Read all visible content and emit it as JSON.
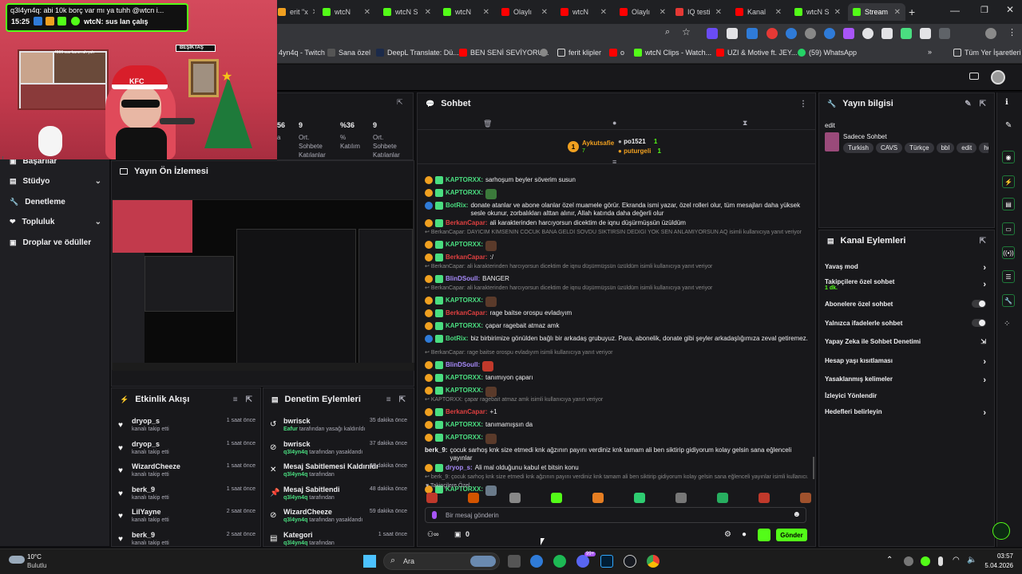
{
  "browser": {
    "tabs": [
      {
        "label": "erit \"x",
        "color": "#f0a020"
      },
      {
        "label": "wtcN",
        "color": "#53fc18"
      },
      {
        "label": "wtcN S",
        "color": "#53fc18"
      },
      {
        "label": "wtcN",
        "color": "#53fc18"
      },
      {
        "label": "Olaylı",
        "color": "#ff0000"
      },
      {
        "label": "wtcN",
        "color": "#ff0000"
      },
      {
        "label": "Olaylı",
        "color": "#ff0000"
      },
      {
        "label": "IQ testi",
        "color": "#e53935"
      },
      {
        "label": "Kanal",
        "color": "#ff0000"
      },
      {
        "label": "wtcN S",
        "color": "#53fc18"
      },
      {
        "label": "Stream",
        "color": "#53fc18"
      }
    ],
    "bookmarks": [
      "4yn4q - Twitch",
      "Sana özel",
      "DeepL Translate: Dü...",
      "BEN SENİ SEVİYORU...",
      "ferit klipler",
      "o",
      "wtcN Clips - Watch...",
      "UZI & Motive ft. JEY...",
      "(59) WhatsApp",
      "Tüm Yer İşaretleri"
    ]
  },
  "overlay": {
    "chat_top": "q3l4yn4q: abi 10k borç var mı ya tuhh @wtcn i...",
    "time": "15:25",
    "chat_bottom": "wtcN: sus lan çalış",
    "sign": "BEŞİKTAŞ",
    "cap": "KFC",
    "small_text": "4666 sus kanın ah ysh"
  },
  "stats": [
    {
      "value": "56",
      "label": "a"
    },
    {
      "value": "9",
      "label": "Ort. Sohbete Katılanlar"
    },
    {
      "value": "%36",
      "label": "% Katılım"
    },
    {
      "value": "9",
      "label": "Ort. Sohbete Katılanlar"
    }
  ],
  "leftnav": [
    {
      "label": "Başarılar",
      "chev": ""
    },
    {
      "label": "Stüdyo",
      "chev": "⌄"
    },
    {
      "label": "Denetleme",
      "chev": ""
    },
    {
      "label": "Topluluk",
      "chev": "⌄"
    },
    {
      "label": "Droplar ve ödüller",
      "chev": ""
    }
  ],
  "preview": {
    "title": "Yayın Ön İzlemesi"
  },
  "activity": {
    "title": "Etkinlik Akışı",
    "items": [
      {
        "name": "dryop_s",
        "sub": "kanalı takip etti",
        "time": "1 saat önce"
      },
      {
        "name": "dryop_s",
        "sub": "kanalı takip etti",
        "time": "1 saat önce"
      },
      {
        "name": "WizardCheeze",
        "sub": "kanalı takip etti",
        "time": "1 saat önce"
      },
      {
        "name": "berk_9",
        "sub": "kanalı takip etti",
        "time": "1 saat önce"
      },
      {
        "name": "LilYayne",
        "sub": "kanalı takip etti",
        "time": "2 saat önce"
      },
      {
        "name": "berk_9",
        "sub": "kanalı takip etti",
        "time": "2 saat önce"
      }
    ]
  },
  "moderation": {
    "title": "Denetim Eylemleri",
    "items": [
      {
        "icon": "↺",
        "name": "bwrisck",
        "actor": "Eafur",
        "sub": " tarafından yasağı kaldırıldı",
        "time": "35 dakika önce"
      },
      {
        "icon": "⊘",
        "name": "bwrisck",
        "actor": "q3l4yn4q",
        "sub": " tarafından yasaklandı",
        "time": "37 dakika önce"
      },
      {
        "icon": "✕",
        "name": "Mesaj Sabitlemesi Kaldırıldı",
        "actor": "q3l4yn4q",
        "sub": " tarafından",
        "time": "48 dakika önce"
      },
      {
        "icon": "📌",
        "name": "Mesaj Sabitlendi",
        "actor": "q3l4yn4q",
        "sub": " tarafından",
        "time": "48 dakika önce"
      },
      {
        "icon": "⊘",
        "name": "WizardCheeze",
        "actor": "q3l4yn4q",
        "sub": " tarafından yasaklandı",
        "time": "59 dakika önce"
      },
      {
        "icon": "▤",
        "name": "Kategori",
        "actor": "q3l4yn4q",
        "sub": " tarafından",
        "time": "1 saat önce"
      }
    ]
  },
  "chat": {
    "title": "Sohbet",
    "pinned_users": [
      {
        "name": "Aykutsafie",
        "count": "7"
      },
      {
        "name": "po1521",
        "count": "1"
      },
      {
        "name": "puturgeli",
        "count": "1"
      }
    ],
    "messages": [
      {
        "kind": "msg",
        "user": "KAPTORXX",
        "color": "#4ade80",
        "text": "sarhoşum beyler söverim susun",
        "badge": "#f0a020"
      },
      {
        "kind": "msg",
        "user": "KAPTORXX",
        "color": "#4ade80",
        "text": "",
        "badge": "#f0a020",
        "emote": "#3b7a3b"
      },
      {
        "kind": "msg",
        "user": "BotRix",
        "color": "#4ade80",
        "text": "donate atanlar ve abone olanlar özel muamele görür. Ekranda ismi yazar, özel rolleri olur, tüm mesajları daha yüksek sesle okunur, zorbalıkları alttan alınır, Allah katında daha değerli olur",
        "badge": "#2f7bd8"
      },
      {
        "kind": "msg",
        "user": "BerkanCapar",
        "color": "#e04040",
        "text": "ali karakterinden harcıyorsun dicektim de iqnu düşürmüşsün üzüldüm",
        "badge": "#f0a020"
      },
      {
        "kind": "reply",
        "text": "BerkanCapar: DAYICIM KİMSENİN COCUK BANA GELDİ SOVDU SİKTİRSİN DEDİGİ YOK SEN ANLAMIYORSUN AQ isimli kullanıcıya yanıt veriyor"
      },
      {
        "kind": "msg",
        "user": "KAPTORXX",
        "color": "#4ade80",
        "text": "",
        "badge": "#f0a020",
        "emote": "#5a3a2a"
      },
      {
        "kind": "msg",
        "user": "BerkanCapar",
        "color": "#e04040",
        "text": ":/",
        "badge": "#f0a020"
      },
      {
        "kind": "reply",
        "text": "BerkanCapar: ali karakterinden harcıyorsun dicektim de iqnu düşürmüşsün üzüldüm isimli kullanıcıya yanıt veriyor"
      },
      {
        "kind": "msg",
        "user": "BlinDSoull",
        "color": "#a78bfa",
        "text": "BANGER",
        "badge": "#f0a020"
      },
      {
        "kind": "reply",
        "text": "BerkanCapar: ali karakterinden harcıyorsun dicektim de iqnu düşürmüşsün üzüldüm isimli kullanıcıya yanıt veriyor"
      },
      {
        "kind": "msg",
        "user": "KAPTORXX",
        "color": "#4ade80",
        "text": "",
        "badge": "#f0a020",
        "emote": "#5a3a2a"
      },
      {
        "kind": "msg",
        "user": "BerkanCapar",
        "color": "#e04040",
        "text": "rage baitse orospu evladıyım",
        "badge": "#f0a020"
      },
      {
        "kind": "msg",
        "user": "KAPTORXX",
        "color": "#4ade80",
        "text": "çapar ragebait atmaz amk",
        "badge": "#f0a020"
      },
      {
        "kind": "msg",
        "user": "BotRix",
        "color": "#4ade80",
        "text": "biz birbirimize gönülden bağlı bir arkadaş grubuyuz. Para, abonelik, donate gibi şeyler arkadaşlığımıza zeval getiremez.",
        "badge": "#2f7bd8"
      },
      {
        "kind": "reply",
        "text": "BerkanCapar: rage baitse orospu evladıyım isimli kullanıcıya yanıt veriyor"
      },
      {
        "kind": "msg",
        "user": "BlinDSoull",
        "color": "#a78bfa",
        "text": "",
        "badge": "#f0a020",
        "emote": "#c0392b"
      },
      {
        "kind": "msg",
        "user": "KAPTORXX",
        "color": "#4ade80",
        "text": "tanımıyon çaparı",
        "badge": "#f0a020"
      },
      {
        "kind": "msg",
        "user": "KAPTORXX",
        "color": "#4ade80",
        "text": "",
        "badge": "#f0a020",
        "emote": "#5a3a2a"
      },
      {
        "kind": "reply",
        "text": "KAPTORXX: çapar ragebait atmaz amk isimli kullanıcıya yanıt veriyor"
      },
      {
        "kind": "msg",
        "user": "BerkanCapar",
        "color": "#e04040",
        "text": "+1",
        "badge": "#f0a020"
      },
      {
        "kind": "msg",
        "user": "KAPTORXX",
        "color": "#4ade80",
        "text": "tanımamışsın da",
        "badge": "#f0a020"
      },
      {
        "kind": "msg",
        "user": "KAPTORXX",
        "color": "#4ade80",
        "text": "",
        "badge": "#f0a020",
        "emote": "#5a3a2a"
      },
      {
        "kind": "msg",
        "user": "berk_9",
        "color": "#efeff1",
        "text": "çocuk sarhoş knk size etmedi knk ağzının payını verdiniz knk tamam ali ben siktirip gidiyorum kolay gelsin sana eğlenceli yayınlar",
        "badge": ""
      },
      {
        "kind": "msg",
        "user": "dryop_s",
        "color": "#a78bfa",
        "text": "Ali mal olduğunu kabul et bitsin konu",
        "badge": "#f0a020"
      },
      {
        "kind": "reply",
        "text": "berk_9: çocuk sarhoş knk size etmedi knk ağzının payını verdiniz knk tamam ali ben siktirip gidiyorum kolay gelsin sana eğlenceli yayınlar isimli kullanıcı..."
      },
      {
        "kind": "msg",
        "user": "KAPTORXX",
        "color": "#4ade80",
        "text": "",
        "badge": "#f0a020",
        "emote": "#6a7a8a"
      }
    ],
    "followers_label": "Takipçilere Özel",
    "input_placeholder": "Bir mesaj gönderin",
    "points": "0",
    "send_label": "Gönder"
  },
  "streaminfo": {
    "title": "Yayın bilgisi",
    "edit": "edit",
    "category": "Sadece Sohbet",
    "tags": [
      "Turkish",
      "CAVS",
      "Türkçe",
      "bbl",
      "edit",
      "hottu"
    ]
  },
  "channelactions": {
    "title": "Kanal Eylemleri",
    "rows": [
      {
        "label": "Yavaş mod",
        "type": "chev",
        "sub": ""
      },
      {
        "label": "Takipçilere özel sohbet",
        "type": "chev",
        "sub": "1 dk."
      },
      {
        "label": "Abonelere özel sohbet",
        "type": "toggle",
        "sub": ""
      },
      {
        "label": "Yalnızca ifadelerle sohbet",
        "type": "toggle",
        "sub": ""
      },
      {
        "label": "Yapay Zeka ile Sohbet Denetimi",
        "type": "ext",
        "sub": ""
      },
      {
        "label": "Hesap yaşı kısıtlaması",
        "type": "chev",
        "sub": ""
      },
      {
        "label": "Yasaklanmış kelimeler",
        "type": "chev",
        "sub": ""
      },
      {
        "label": "İzleyici Yönlendir",
        "type": "none",
        "sub": ""
      },
      {
        "label": "Hedefleri belirleyin",
        "type": "chev",
        "sub": ""
      }
    ]
  },
  "taskbar": {
    "weather_temp": "10°C",
    "weather_desc": "Bulutlu",
    "search": "Ara",
    "time": "03:57",
    "date": "5.04.2026",
    "badge": "99+"
  },
  "colors": {
    "accent": "#53fc18",
    "bg": "#0e0e10",
    "panel": "#18181b"
  }
}
